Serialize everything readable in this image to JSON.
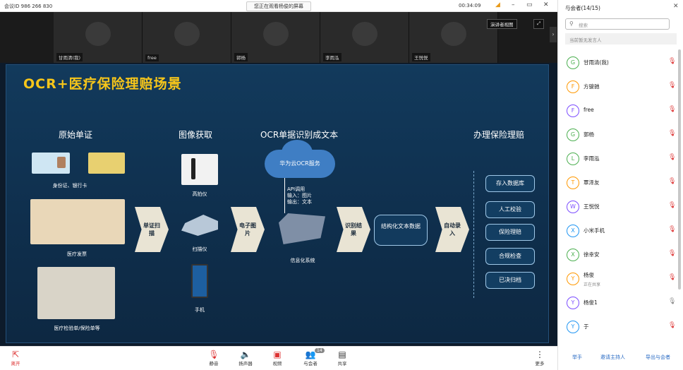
{
  "titlebar": {
    "meeting_id": "会议ID 986 266 830",
    "banner": "您正在观看杨俊的屏幕",
    "time": "00:34:09",
    "min_icon": "minimize-icon",
    "max_icon": "restore-icon",
    "close_icon": "close-icon"
  },
  "video": {
    "tiles": [
      "甘雨清(我)",
      "free",
      "郭杨",
      "李雨泓",
      "王悦悦"
    ],
    "gallery_button": "演讲者视图"
  },
  "slide": {
    "title": "OCR+医疗保险理赔场景",
    "h1": "原始单证",
    "h2": "图像获取",
    "h3": "OCR单据识别成文本",
    "h4": "办理保险理赔",
    "cap_id": "身份证、银行卡",
    "cap_invoice": "医疗发票",
    "cap_lab": "医疗检验单/保险单等",
    "cap_scanner_hi": "高拍仪",
    "cap_scanner": "扫描仪",
    "cap_phone": "手机",
    "chev1": "单证扫描",
    "chev2": "电子图片",
    "chev3": "识别结果",
    "chev4": "自动录入",
    "cloud": "华为云OCR服务",
    "api1": "API调用",
    "api2": "输入：图片",
    "api3": "输出：文本",
    "system": "信息化系统",
    "struct": "结构化文本数据",
    "r1": "存入数据库",
    "r2": "人工校验",
    "r3": "保险理赔",
    "r4": "合规检查",
    "r5": "已决归档"
  },
  "bottom": {
    "leave": "离开",
    "mute": "静音",
    "speaker": "扬声器",
    "video": "视频",
    "participants": "与会者",
    "participants_count": "14",
    "share": "共享",
    "more": "更多"
  },
  "panel": {
    "title": "与会者(14/15)",
    "search_placeholder": "搜索",
    "host_note": "当前暂无发言人",
    "people": [
      {
        "initial": "G",
        "name": "甘雨清(我)",
        "color": "#4caf50"
      },
      {
        "initial": "F",
        "name": "方骏驰",
        "color": "#ff9800"
      },
      {
        "initial": "F",
        "name": "free",
        "color": "#7c4dff"
      },
      {
        "initial": "G",
        "name": "郭杨",
        "color": "#4caf50"
      },
      {
        "initial": "L",
        "name": "李雨泓",
        "color": "#4caf50"
      },
      {
        "initial": "T",
        "name": "覃泽友",
        "color": "#ff9800"
      },
      {
        "initial": "W",
        "name": "王悦悦",
        "color": "#7c4dff"
      },
      {
        "initial": "X",
        "name": "小米手机",
        "color": "#2196f3"
      },
      {
        "initial": "X",
        "name": "徐幸安",
        "color": "#4caf50"
      },
      {
        "initial": "Y",
        "name": "杨俊",
        "sub": "正在共享",
        "color": "#ff9800"
      },
      {
        "initial": "Y",
        "name": "杨俊1",
        "color": "#7c4dff"
      },
      {
        "initial": "Y",
        "name": "于",
        "color": "#2196f3"
      }
    ],
    "raise_hand": "举手",
    "invite": "邀请主持人",
    "export": "导出与会者"
  }
}
